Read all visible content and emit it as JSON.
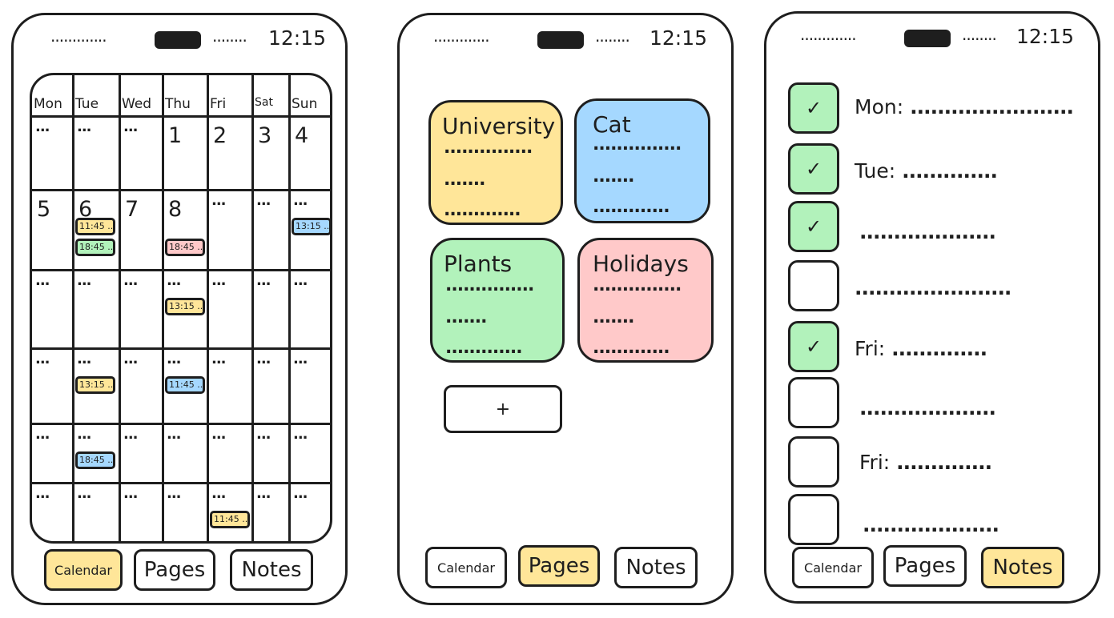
{
  "status": {
    "time": "12:15"
  },
  "tabs": {
    "calendar": "Calendar",
    "pages": "Pages",
    "notes": "Notes"
  },
  "colors": {
    "yellow": "#ffe699",
    "green": "#b2f2bb",
    "blue": "#a5d8ff",
    "red": "#ffc9c9"
  },
  "calendar": {
    "days": [
      "Mon",
      "Tue",
      "Wed",
      "Thu",
      "Fri",
      "Sat",
      "Sun"
    ],
    "weeks": [
      [
        "...",
        "...",
        "...",
        "1",
        "2",
        "3",
        "4"
      ],
      [
        "5",
        "6",
        "7",
        "8",
        "...",
        "...",
        "..."
      ],
      [
        "...",
        "...",
        "...",
        "...",
        "...",
        "...",
        "..."
      ],
      [
        "...",
        "...",
        "...",
        "...",
        "...",
        "...",
        "..."
      ],
      [
        "...",
        "...",
        "...",
        "...",
        "...",
        "...",
        "..."
      ],
      [
        "...",
        "...",
        "...",
        "...",
        "...",
        "...",
        "..."
      ]
    ],
    "events": [
      {
        "week": 1,
        "day": 1,
        "slot": 0,
        "time": "11:45 ..",
        "color": "yellow"
      },
      {
        "week": 1,
        "day": 1,
        "slot": 1,
        "time": "18:45 ..",
        "color": "green"
      },
      {
        "week": 1,
        "day": 3,
        "slot": 1,
        "time": "18:45 ..",
        "color": "red"
      },
      {
        "week": 1,
        "day": 6,
        "slot": 0,
        "time": "13:15 ..",
        "color": "blue"
      },
      {
        "week": 2,
        "day": 3,
        "slot": 0,
        "time": "13:15 ..",
        "color": "yellow"
      },
      {
        "week": 3,
        "day": 1,
        "slot": 0,
        "time": "13:15 ..",
        "color": "yellow"
      },
      {
        "week": 3,
        "day": 3,
        "slot": 0,
        "time": "11:45 ..",
        "color": "blue"
      },
      {
        "week": 4,
        "day": 1,
        "slot": 0,
        "time": "18:45 ..",
        "color": "blue"
      },
      {
        "week": 5,
        "day": 4,
        "slot": 0,
        "time": "11:45 ..",
        "color": "yellow"
      }
    ]
  },
  "pages": {
    "cards": [
      {
        "title": "University",
        "color": "yellow",
        "lines": [
          "...............",
          ".......",
          "............."
        ]
      },
      {
        "title": "Cat",
        "color": "blue",
        "lines": [
          "...............",
          ".......",
          "............."
        ]
      },
      {
        "title": "Plants",
        "color": "green",
        "lines": [
          "...............",
          ".......",
          "............."
        ]
      },
      {
        "title": "Holidays",
        "color": "red",
        "lines": [
          "...............",
          ".......",
          "............."
        ]
      }
    ],
    "add_label": "+"
  },
  "notes": {
    "items": [
      {
        "checked": true,
        "label": "Mon:",
        "dots": "........................"
      },
      {
        "checked": true,
        "label": "Tue:",
        "dots": ".............."
      },
      {
        "checked": true,
        "label": "",
        "dots": "...................."
      },
      {
        "checked": false,
        "label": "",
        "dots": "......................."
      },
      {
        "checked": true,
        "label": "Fri:",
        "dots": ".............."
      },
      {
        "checked": false,
        "label": "",
        "dots": "...................."
      },
      {
        "checked": false,
        "label": "Fri:",
        "dots": ".............."
      },
      {
        "checked": false,
        "label": "",
        "dots": "...................."
      }
    ],
    "check_mark": "✓"
  }
}
